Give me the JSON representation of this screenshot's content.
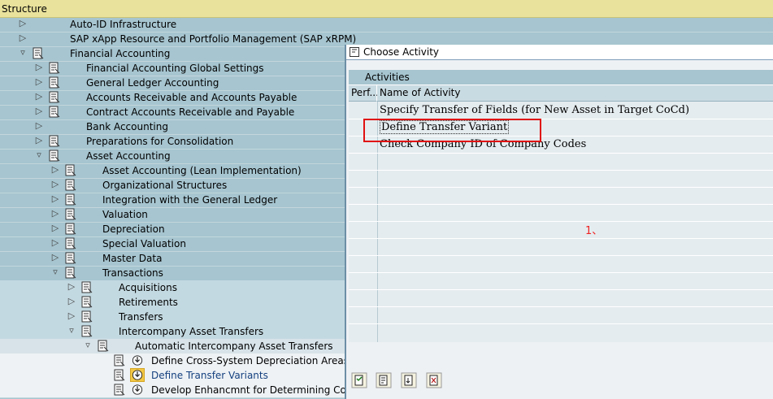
{
  "structure": {
    "header_label": "Structure",
    "nodes": [
      {
        "label": "Auto-ID Infrastructure"
      },
      {
        "label": "SAP xApp Resource and Portfolio Management (SAP xRPM)"
      },
      {
        "label": "Financial Accounting"
      },
      {
        "label": "Financial Accounting Global Settings"
      },
      {
        "label": "General Ledger Accounting"
      },
      {
        "label": "Accounts Receivable and Accounts Payable"
      },
      {
        "label": "Contract Accounts Receivable and Payable"
      },
      {
        "label": "Bank Accounting"
      },
      {
        "label": "Preparations for Consolidation"
      },
      {
        "label": "Asset Accounting"
      },
      {
        "label": "Asset Accounting (Lean Implementation)"
      },
      {
        "label": "Organizational Structures"
      },
      {
        "label": "Integration with the General Ledger"
      },
      {
        "label": "Valuation"
      },
      {
        "label": "Depreciation"
      },
      {
        "label": "Special Valuation"
      },
      {
        "label": "Master Data"
      },
      {
        "label": "Transactions"
      },
      {
        "label": "Acquisitions"
      },
      {
        "label": "Retirements"
      },
      {
        "label": "Transfers"
      },
      {
        "label": "Intercompany Asset Transfers"
      },
      {
        "label": "Automatic Intercompany Asset Transfers"
      },
      {
        "label": "Define Cross-System Depreciation Areas"
      },
      {
        "label": "Define Transfer Variants"
      },
      {
        "label": "Develop Enhancmnt for Determining Compa"
      }
    ]
  },
  "dialog": {
    "title": "Choose Activity",
    "table_title": "Activities",
    "col_perform": "Perf...",
    "col_name": "Name of Activity",
    "activities": [
      "Specify Transfer of Fields (for New Asset in Target CoCd)",
      "Define Transfer Variant",
      "Check Company ID of Company Codes"
    ],
    "annotation": "1、"
  },
  "colors": {
    "tree_background": "#a6c5d0",
    "header_background": "#e9e29c",
    "highlight_box": "#e01010",
    "annotation": "#ee2222"
  }
}
